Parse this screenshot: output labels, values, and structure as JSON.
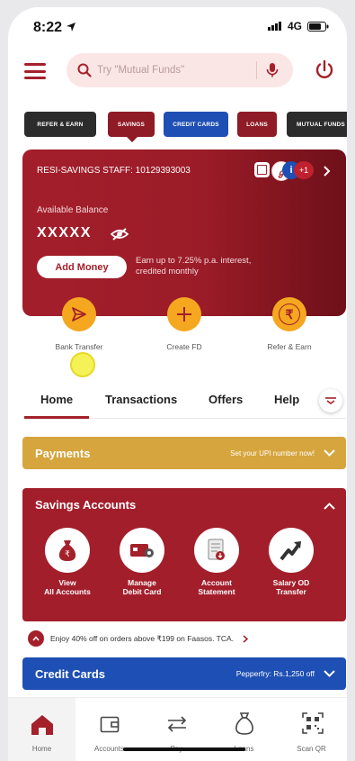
{
  "status": {
    "time": "8:22",
    "network": "4G"
  },
  "search": {
    "placeholder": "Try \"Mutual Funds\""
  },
  "pills": [
    {
      "label": "REFER & EARN",
      "color": "#2c2c2c"
    },
    {
      "label": "SAVINGS",
      "color": "#8e1b25"
    },
    {
      "label": "CREDIT CARDS",
      "color": "#1e4fb4"
    },
    {
      "label": "LOANS",
      "color": "#8e1b25"
    },
    {
      "label": "MUTUAL FUNDS",
      "color": "#2c2c2c"
    }
  ],
  "card": {
    "account": "RESI-SAVINGS STAFF: 10129393003",
    "more_count": "+1",
    "available_label": "Available Balance",
    "balance": "XXXXX",
    "add_money": "Add Money",
    "earn_text_1": "Earn up to 7.25% p.a. interest,",
    "earn_text_2": "credited monthly"
  },
  "quick_actions": [
    {
      "label": "Bank Transfer",
      "icon": "send-icon"
    },
    {
      "label": "Create FD",
      "icon": "plus-icon"
    },
    {
      "label": "Refer & Earn",
      "icon": "rupee-icon"
    }
  ],
  "tabs": [
    {
      "label": "Home"
    },
    {
      "label": "Transactions"
    },
    {
      "label": "Offers"
    },
    {
      "label": "Help"
    }
  ],
  "payments": {
    "title": "Payments",
    "cta": "Set your UPI number now!"
  },
  "savings": {
    "title": "Savings Accounts",
    "items": [
      {
        "line1": "View",
        "line2": "All Accounts",
        "icon": "money-bag-icon"
      },
      {
        "line1": "Manage",
        "line2": "Debit Card",
        "icon": "debit-card-icon"
      },
      {
        "line1": "Account",
        "line2": "Statement",
        "icon": "statement-icon"
      },
      {
        "line1": "Salary OD",
        "line2": "Transfer",
        "icon": "trend-arrow-icon"
      }
    ]
  },
  "offer": {
    "text": "Enjoy 40% off on orders above ₹199 on Faasos. TCA."
  },
  "credit_cards": {
    "title": "Credit Cards",
    "cta": "Pepperfry: Rs.1,250 off"
  },
  "nav": [
    {
      "label": "Home",
      "icon": "home-icon"
    },
    {
      "label": "Accounts",
      "icon": "wallet-icon"
    },
    {
      "label": "Pay",
      "icon": "transfer-arrows-icon"
    },
    {
      "label": "Loans",
      "icon": "money-bag-outline-icon"
    },
    {
      "label": "Scan QR",
      "icon": "qr-code-icon"
    }
  ],
  "colors": {
    "brand": "#a4202a",
    "accent": "#f4a71f",
    "payments": "#d6a53d",
    "credit": "#1e4fb4"
  }
}
